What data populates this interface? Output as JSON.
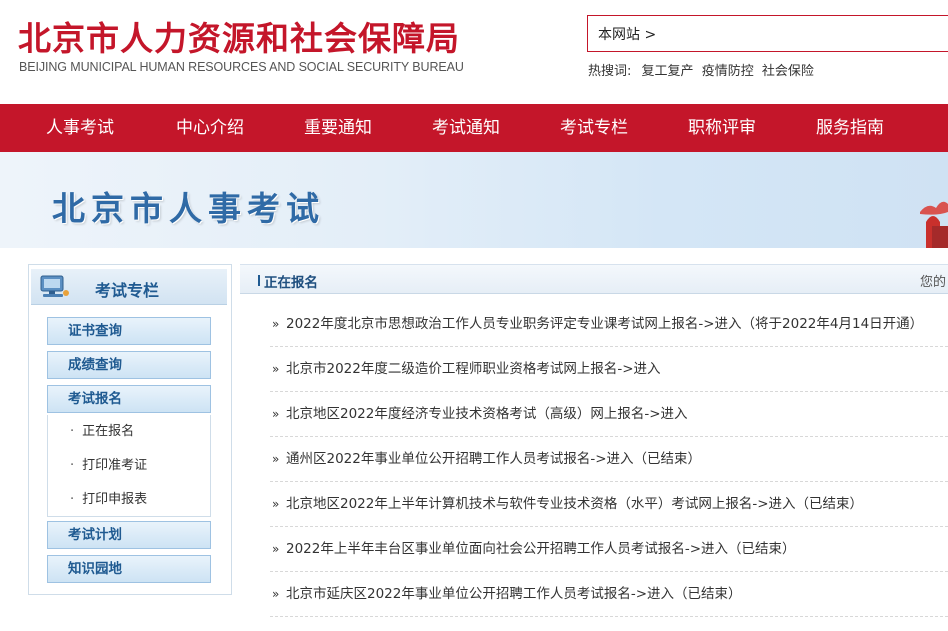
{
  "header": {
    "title_cn": "北京市人力资源和社会保障局",
    "title_en": "BEIJING MUNICIPAL HUMAN RESOURCES AND SOCIAL SECURITY BUREAU",
    "search_scope": "本网站 >",
    "hot_label": "热搜词:",
    "hot_links": [
      "复工复产",
      "疫情防控",
      "社会保险"
    ]
  },
  "nav": {
    "items": [
      "人事考试",
      "中心介绍",
      "重要通知",
      "考试通知",
      "考试专栏",
      "职称评审",
      "服务指南"
    ]
  },
  "banner": {
    "title": "北京市人事考试"
  },
  "sidebar": {
    "title": "考试专栏",
    "buttons": [
      "证书查询",
      "成绩查询",
      "考试报名",
      "考试计划",
      "知识园地"
    ],
    "subitems": [
      "正在报名",
      "打印准考证",
      "打印申报表"
    ],
    "dot": "·"
  },
  "main": {
    "title": "正在报名",
    "right_text": "您的",
    "bullet": "»",
    "items": [
      "2022年度北京市思想政治工作人员专业职务评定专业课考试网上报名->进入（将于2022年4月14日开通）",
      "北京市2022年度二级造价工程师职业资格考试网上报名->进入",
      "北京地区2022年度经济专业技术资格考试（高级）网上报名->进入",
      "通州区2022年事业单位公开招聘工作人员考试报名->进入（已结束）",
      "北京地区2022年上半年计算机技术与软件专业技术资格（水平）考试网上报名->进入（已结束）",
      "2022年上半年丰台区事业单位面向社会公开招聘工作人员考试报名->进入（已结束）",
      "北京市延庆区2022年事业单位公开招聘工作人员考试报名->进入（已结束）"
    ]
  },
  "colors": {
    "brand_red": "#c4162a",
    "accent_blue": "#1f5a91"
  }
}
